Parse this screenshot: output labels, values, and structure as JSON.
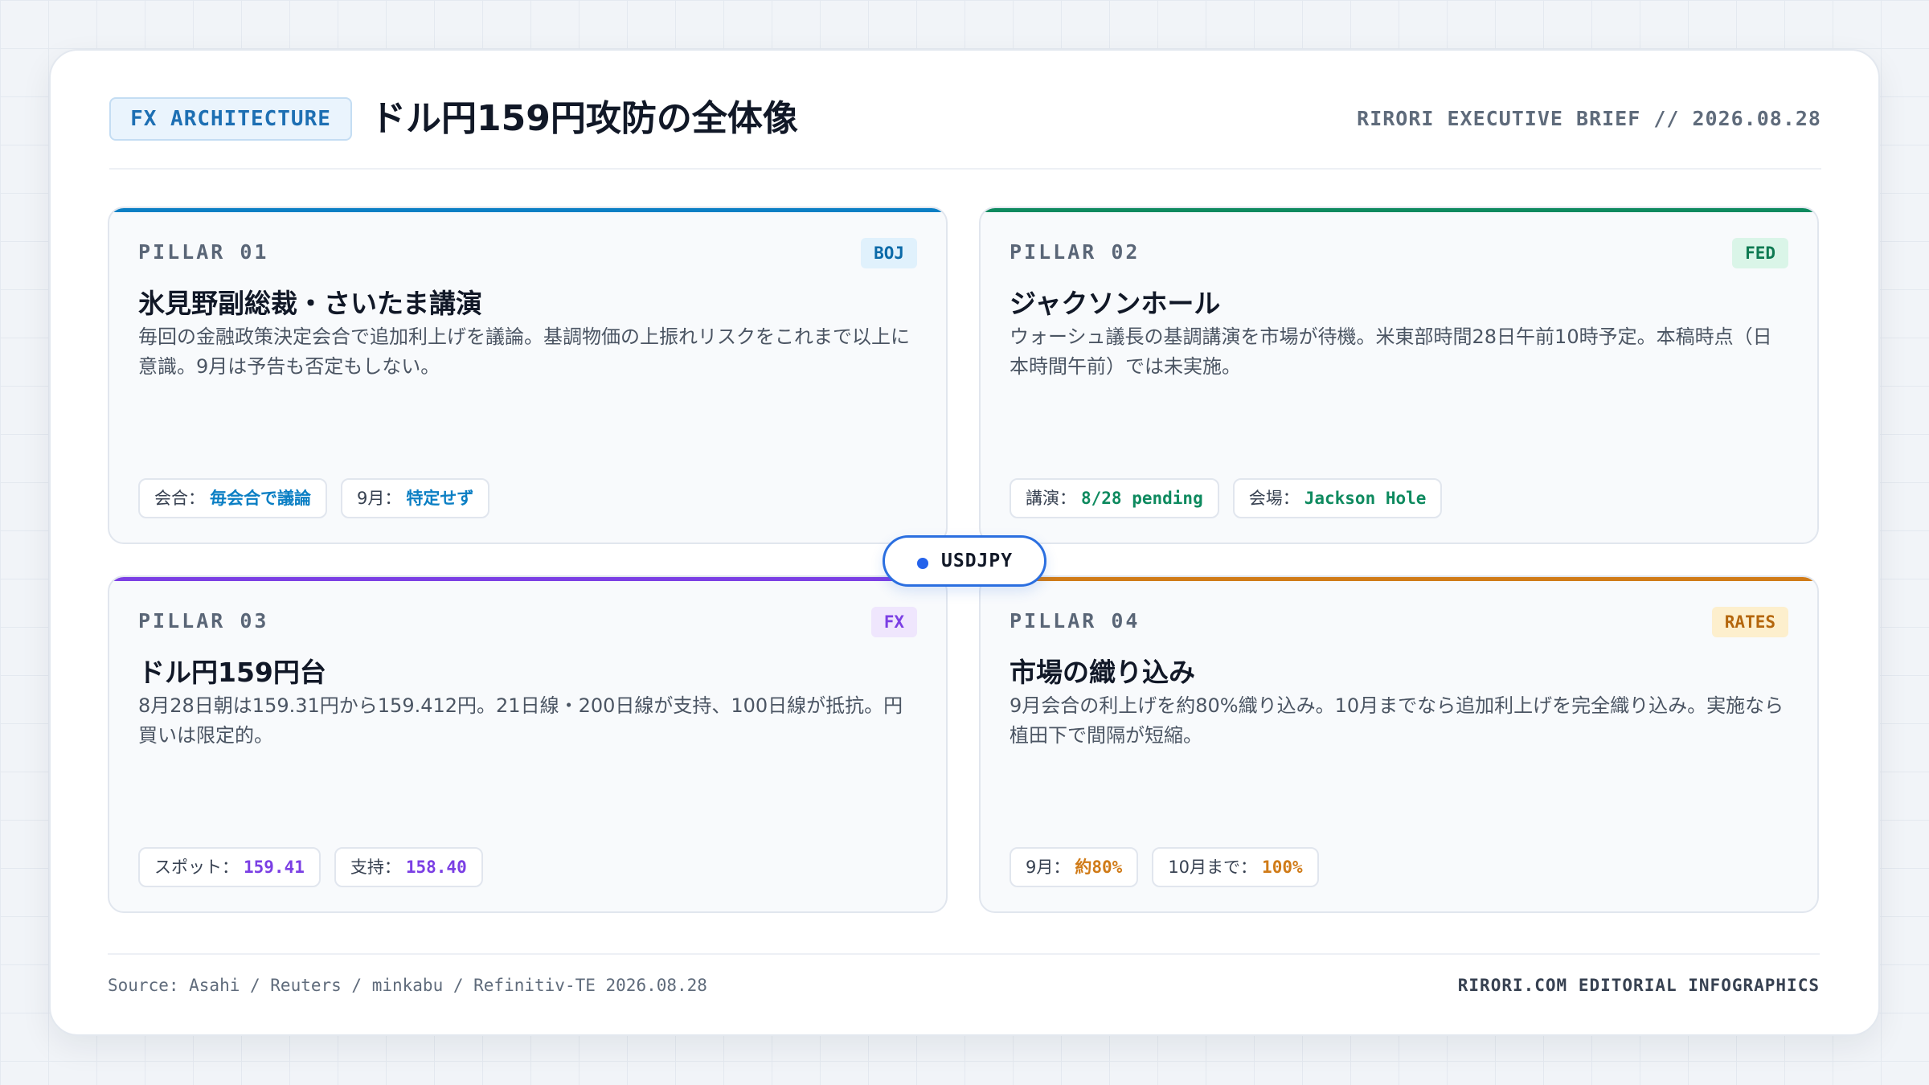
{
  "header": {
    "tag": "FX ARCHITECTURE",
    "title": "ドル円159円攻防の全体像",
    "brief": "RIRORI EXECUTIVE BRIEF // 2026.08.28"
  },
  "hub": {
    "label": "USDJPY",
    "color": "#2563eb"
  },
  "pillars": [
    {
      "number": "PILLAR 01",
      "badge": "BOJ",
      "accent": "#0b7fc4",
      "title": "氷見野副総裁・さいたま講演",
      "description": "毎回の金融政策決定会合で追加利上げを議論。基調物価の上振れリスクをこれまで以上に意識。9月は予告も否定もしない。",
      "chips": [
        {
          "label": "会合：",
          "value": "毎会合で議論"
        },
        {
          "label": "9月：",
          "value": "特定せず"
        }
      ]
    },
    {
      "number": "PILLAR 02",
      "badge": "FED",
      "accent": "#0e8a5f",
      "title": "ジャクソンホール",
      "description": "ウォーシュ議長の基調講演を市場が待機。米東部時間28日午前10時予定。本稿時点（日本時間午前）では未実施。",
      "chips": [
        {
          "label": "講演：",
          "value": "8/28 pending"
        },
        {
          "label": "会場：",
          "value": "Jackson Hole"
        }
      ]
    },
    {
      "number": "PILLAR 03",
      "badge": "FX",
      "accent": "#7b3fe4",
      "title": "ドル円159円台",
      "description": "8月28日朝は159.31円から159.412円。21日線・200日線が支持、100日線が抵抗。円買いは限定的。",
      "chips": [
        {
          "label": "スポット：",
          "value": "159.41"
        },
        {
          "label": "支持：",
          "value": "158.40"
        }
      ]
    },
    {
      "number": "PILLAR 04",
      "badge": "RATES",
      "accent": "#d07b18",
      "title": "市場の織り込み",
      "description": "9月会合の利上げを約80%織り込み。10月までなら追加利上げを完全織り込み。実施なら植田下で間隔が短縮。",
      "chips": [
        {
          "label": "9月：",
          "value": "約80%"
        },
        {
          "label": "10月まで：",
          "value": "100%"
        }
      ]
    }
  ],
  "footer": {
    "source": "Source: Asahi / Reuters / minkabu / Refinitiv-TE 2026.08.28",
    "credit": "RIRORI.COM EDITORIAL INFOGRAPHICS"
  }
}
